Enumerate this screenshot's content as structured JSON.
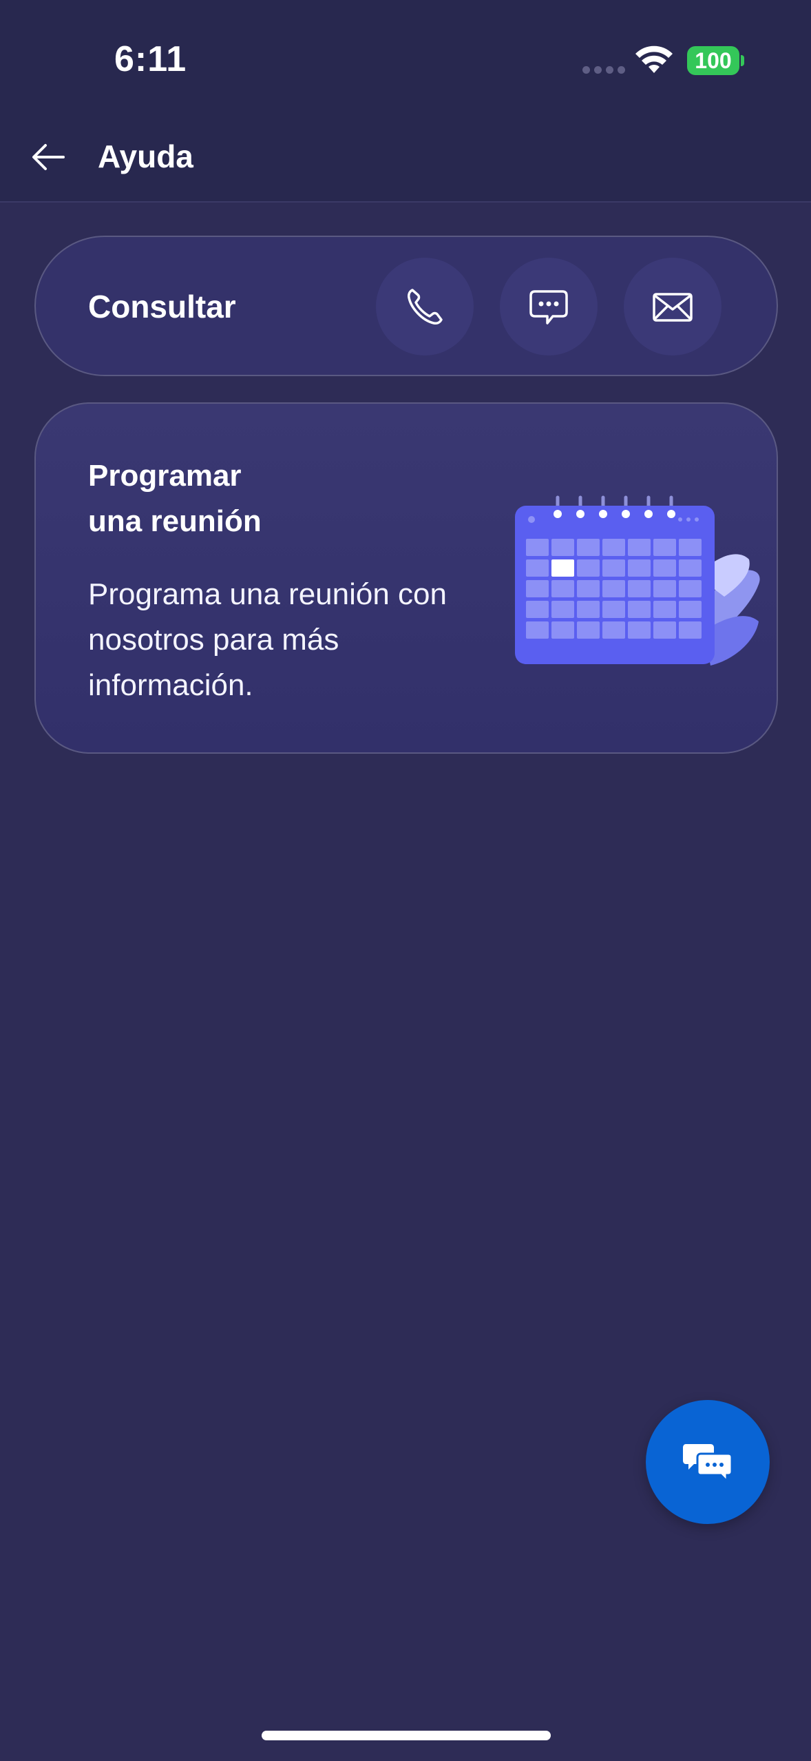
{
  "status_bar": {
    "time": "6:11",
    "battery_level": "100",
    "battery_color": "#34c759"
  },
  "app_bar": {
    "title": "Ayuda",
    "back_icon": "arrow-left-icon"
  },
  "consult": {
    "label": "Consultar",
    "actions": [
      {
        "icon": "phone-icon"
      },
      {
        "icon": "message-dots-icon"
      },
      {
        "icon": "mail-icon"
      }
    ]
  },
  "meeting": {
    "title_line1": "Programar",
    "title_line2": "una reunión",
    "description": "Programa una reunión con nosotros para más información.",
    "illustration": "calendar-icon"
  },
  "fab": {
    "icon": "chat-bubbles-icon",
    "color": "#0964d4"
  },
  "theme": {
    "background": "#2e2c56",
    "card": "#34326a",
    "accent": "#5b5ef0"
  }
}
